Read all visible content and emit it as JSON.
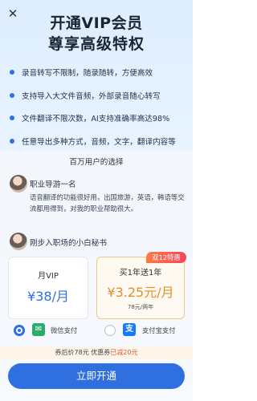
{
  "header": {
    "close_icon": "close-icon",
    "title_line1": "开通VIP会员",
    "title_line2": "尊享高级特权"
  },
  "features": [
    {
      "text": "录音转写不限制，随录随转，方便高效"
    },
    {
      "text": "支持导入大文件音频，外部录音随心转写"
    },
    {
      "text": "文件翻译不限次数，AI支持准确率高达98%"
    },
    {
      "text": "任意导出多种方式，音频，文字，翻译内容等"
    }
  ],
  "testimonials": {
    "heading": "百万用户的选择",
    "items": [
      {
        "name": "职业导游一名",
        "quote": "语音翻译的功能很好用，出国旅游，英语，韩语等交流都用得到，对我的职业帮助很大。"
      },
      {
        "name": "刚步入职场的小白秘书"
      }
    ]
  },
  "plans": [
    {
      "label": "月VIP",
      "price": "¥38/月"
    },
    {
      "label": "买1年送1年",
      "price": "¥3.25元/月",
      "sub": "78元/两年",
      "badge": "双12特惠"
    }
  ],
  "payment": {
    "wechat_label": "微信支付",
    "alipay_label": "支付宝支付",
    "selected": "wechat",
    "colors": {
      "wechat": "#2aae67",
      "alipay": "#1677ff",
      "accent": "#2f6fe0"
    }
  },
  "promo": {
    "text": "券后价78元 优惠券",
    "accent": "已减20元"
  },
  "cta": {
    "label": "立即开通"
  }
}
